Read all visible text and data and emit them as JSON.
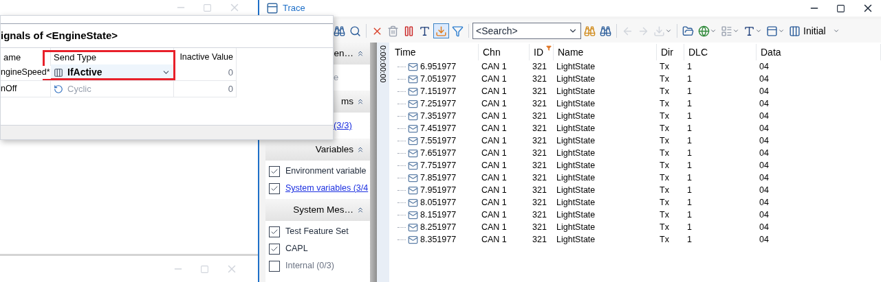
{
  "dialog": {
    "title": "ignals of <EngineState>",
    "columns": [
      "ame",
      "Send Type",
      "Inactive Value"
    ],
    "rows": [
      {
        "name": "ngineSpeed*",
        "send_type": "IfActive",
        "kind": "ifactive",
        "editing": true,
        "inactive_value": "0"
      },
      {
        "name": "nOff",
        "send_type": "Cyclic",
        "kind": "cyclic",
        "editing": false,
        "inactive_value": "0"
      }
    ]
  },
  "trace": {
    "title": "Trace",
    "search_placeholder": "<Search>",
    "layout_label": "Initial",
    "filter_panel": [
      {
        "title": "en…",
        "items": [
          {
            "label": "e",
            "kind": "partial",
            "link": false
          }
        ]
      },
      {
        "title": "ms",
        "items": [
          {
            "label": "(3/3)",
            "kind": "partial",
            "link": true
          }
        ]
      },
      {
        "title": "Variables",
        "items": [
          {
            "label": "Environment variable",
            "kind": "checkbox",
            "checked": true,
            "link": false
          },
          {
            "label": "System variables (3/4",
            "kind": "checkbox",
            "checked": true,
            "link": true
          }
        ]
      },
      {
        "title": "System Mes…",
        "items": [
          {
            "label": "Test Feature Set",
            "kind": "checkbox",
            "checked": true,
            "link": false
          },
          {
            "label": "CAPL",
            "kind": "checkbox",
            "checked": true,
            "link": false
          },
          {
            "label": "Internal (0/3)",
            "kind": "checkbox",
            "checked": false,
            "link": false
          }
        ]
      }
    ],
    "timeline_label": "0:00:00:00",
    "columns": [
      {
        "label": "Time",
        "filtered": false
      },
      {
        "label": "Chn",
        "filtered": false
      },
      {
        "label": "ID",
        "filtered": true
      },
      {
        "label": "Name",
        "filtered": false
      },
      {
        "label": "Dir",
        "filtered": false
      },
      {
        "label": "DLC",
        "filtered": false
      },
      {
        "label": "Data",
        "filtered": false
      }
    ],
    "rows": [
      [
        "6.951977",
        "CAN 1",
        "321",
        "LightState",
        "Tx",
        "1",
        "04"
      ],
      [
        "7.051977",
        "CAN 1",
        "321",
        "LightState",
        "Tx",
        "1",
        "04"
      ],
      [
        "7.151977",
        "CAN 1",
        "321",
        "LightState",
        "Tx",
        "1",
        "04"
      ],
      [
        "7.251977",
        "CAN 1",
        "321",
        "LightState",
        "Tx",
        "1",
        "04"
      ],
      [
        "7.351977",
        "CAN 1",
        "321",
        "LightState",
        "Tx",
        "1",
        "04"
      ],
      [
        "7.451977",
        "CAN 1",
        "321",
        "LightState",
        "Tx",
        "1",
        "04"
      ],
      [
        "7.551977",
        "CAN 1",
        "321",
        "LightState",
        "Tx",
        "1",
        "04"
      ],
      [
        "7.651977",
        "CAN 1",
        "321",
        "LightState",
        "Tx",
        "1",
        "04"
      ],
      [
        "7.751977",
        "CAN 1",
        "321",
        "LightState",
        "Tx",
        "1",
        "04"
      ],
      [
        "7.851977",
        "CAN 1",
        "321",
        "LightState",
        "Tx",
        "1",
        "04"
      ],
      [
        "7.951977",
        "CAN 1",
        "321",
        "LightState",
        "Tx",
        "1",
        "04"
      ],
      [
        "8.051977",
        "CAN 1",
        "321",
        "LightState",
        "Tx",
        "1",
        "04"
      ],
      [
        "8.151977",
        "CAN 1",
        "321",
        "LightState",
        "Tx",
        "1",
        "04"
      ],
      [
        "8.251977",
        "CAN 1",
        "321",
        "LightState",
        "Tx",
        "1",
        "04"
      ],
      [
        "8.351977",
        "CAN 1",
        "321",
        "LightState",
        "Tx",
        "1",
        "04"
      ]
    ]
  }
}
